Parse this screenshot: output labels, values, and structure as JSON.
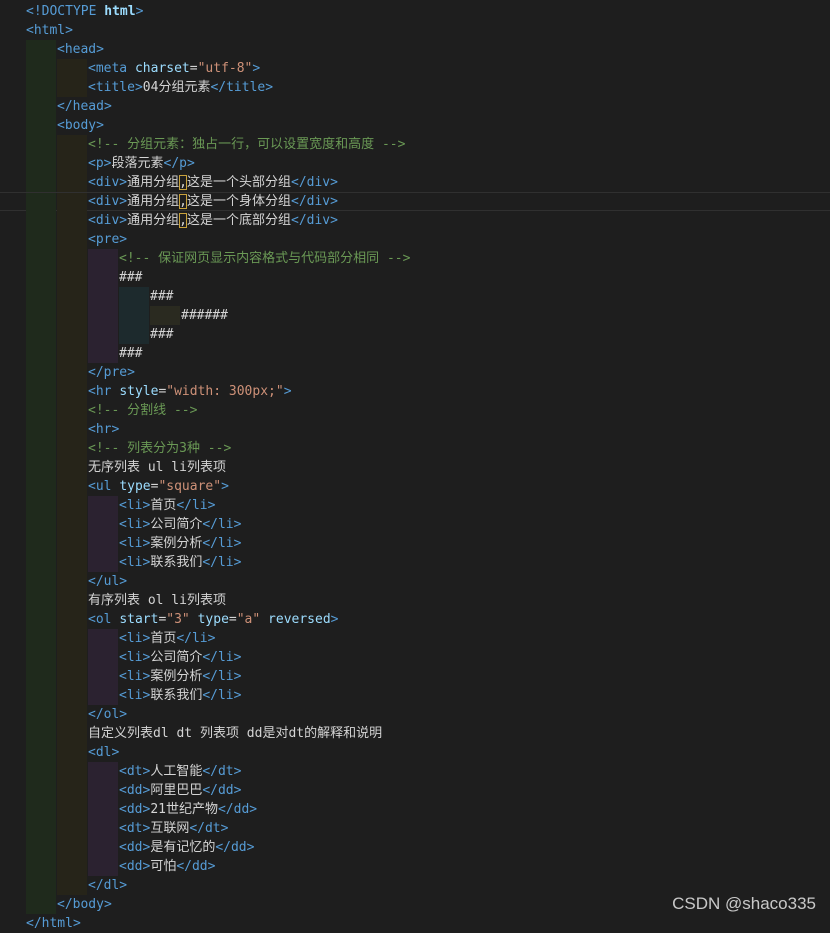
{
  "watermark": "CSDN @shaco335",
  "lines": [
    {
      "indent": 0,
      "segs": [
        {
          "t": "tag",
          "v": "<!DOCTYPE "
        },
        {
          "t": "att-b",
          "v": "html"
        },
        {
          "t": "tag",
          "v": ">"
        }
      ]
    },
    {
      "indent": 0,
      "segs": [
        {
          "t": "tag",
          "v": "<html>"
        }
      ]
    },
    {
      "indent": 1,
      "segs": [
        {
          "t": "tag",
          "v": "<head>"
        }
      ]
    },
    {
      "indent": 2,
      "segs": [
        {
          "t": "tag",
          "v": "<meta "
        },
        {
          "t": "att",
          "v": "charset"
        },
        {
          "t": "txt",
          "v": "="
        },
        {
          "t": "str",
          "v": "\"utf-8\""
        },
        {
          "t": "tag",
          "v": ">"
        }
      ]
    },
    {
      "indent": 2,
      "segs": [
        {
          "t": "tag",
          "v": "<title>"
        },
        {
          "t": "txt",
          "v": "04分组元素"
        },
        {
          "t": "tag",
          "v": "</title>"
        }
      ]
    },
    {
      "indent": 1,
      "segs": [
        {
          "t": "tag",
          "v": "</head>"
        }
      ]
    },
    {
      "indent": 1,
      "segs": [
        {
          "t": "tag",
          "v": "<body>"
        }
      ]
    },
    {
      "indent": 2,
      "segs": [
        {
          "t": "com",
          "v": "<!-- 分组元素：独占一行，可以设置宽度和高度 -->"
        }
      ]
    },
    {
      "indent": 2,
      "segs": [
        {
          "t": "tag",
          "v": "<p>"
        },
        {
          "t": "txt",
          "v": "段落元素"
        },
        {
          "t": "tag",
          "v": "</p>"
        }
      ]
    },
    {
      "indent": 2,
      "segs": [
        {
          "t": "tag",
          "v": "<div>"
        },
        {
          "t": "txt",
          "v": "通用分组"
        },
        {
          "t": "hl",
          "v": ","
        },
        {
          "t": "txt",
          "v": "这是一个头部分组"
        },
        {
          "t": "tag",
          "v": "</div>"
        }
      ]
    },
    {
      "indent": 2,
      "active": true,
      "segs": [
        {
          "t": "tag",
          "v": "<div>"
        },
        {
          "t": "txt",
          "v": "通用分组"
        },
        {
          "t": "hl",
          "v": ","
        },
        {
          "t": "txt",
          "v": "这是一个身体分组"
        },
        {
          "t": "tag",
          "v": "</div>"
        }
      ]
    },
    {
      "indent": 2,
      "segs": [
        {
          "t": "tag",
          "v": "<div>"
        },
        {
          "t": "txt",
          "v": "通用分组"
        },
        {
          "t": "hl",
          "v": ","
        },
        {
          "t": "txt",
          "v": "这是一个底部分组"
        },
        {
          "t": "tag",
          "v": "</div>"
        }
      ]
    },
    {
      "indent": 2,
      "segs": [
        {
          "t": "tag",
          "v": "<pre>"
        }
      ]
    },
    {
      "indent": 3,
      "segs": [
        {
          "t": "com",
          "v": "<!-- 保证网页显示内容格式与代码部分相同 -->"
        }
      ]
    },
    {
      "indent": 3,
      "segs": [
        {
          "t": "txt",
          "v": "###"
        }
      ]
    },
    {
      "indent": 4,
      "segs": [
        {
          "t": "txt",
          "v": "###"
        }
      ]
    },
    {
      "indent": 5,
      "segs": [
        {
          "t": "txt",
          "v": "######"
        }
      ]
    },
    {
      "indent": 4,
      "segs": [
        {
          "t": "txt",
          "v": "###"
        }
      ]
    },
    {
      "indent": 3,
      "segs": [
        {
          "t": "txt",
          "v": "###"
        }
      ]
    },
    {
      "indent": 2,
      "segs": [
        {
          "t": "tag",
          "v": "</pre>"
        }
      ]
    },
    {
      "indent": 2,
      "segs": [
        {
          "t": "tag",
          "v": "<hr "
        },
        {
          "t": "att",
          "v": "style"
        },
        {
          "t": "txt",
          "v": "="
        },
        {
          "t": "str",
          "v": "\"width: 300px;\""
        },
        {
          "t": "tag",
          "v": ">"
        }
      ]
    },
    {
      "indent": 2,
      "segs": [
        {
          "t": "com",
          "v": "<!-- 分割线 -->"
        }
      ]
    },
    {
      "indent": 2,
      "segs": [
        {
          "t": "tag",
          "v": "<hr>"
        }
      ]
    },
    {
      "indent": 2,
      "segs": [
        {
          "t": "com",
          "v": "<!-- 列表分为3种 -->"
        }
      ]
    },
    {
      "indent": 2,
      "segs": [
        {
          "t": "txt",
          "v": "无序列表 ul li列表项"
        }
      ]
    },
    {
      "indent": 2,
      "segs": [
        {
          "t": "tag",
          "v": "<ul "
        },
        {
          "t": "att",
          "v": "type"
        },
        {
          "t": "txt",
          "v": "="
        },
        {
          "t": "str",
          "v": "\"square\""
        },
        {
          "t": "tag",
          "v": ">"
        }
      ]
    },
    {
      "indent": 3,
      "segs": [
        {
          "t": "tag",
          "v": "<li>"
        },
        {
          "t": "txt",
          "v": "首页"
        },
        {
          "t": "tag",
          "v": "</li>"
        }
      ]
    },
    {
      "indent": 3,
      "segs": [
        {
          "t": "tag",
          "v": "<li>"
        },
        {
          "t": "txt",
          "v": "公司简介"
        },
        {
          "t": "tag",
          "v": "</li>"
        }
      ]
    },
    {
      "indent": 3,
      "segs": [
        {
          "t": "tag",
          "v": "<li>"
        },
        {
          "t": "txt",
          "v": "案例分析"
        },
        {
          "t": "tag",
          "v": "</li>"
        }
      ]
    },
    {
      "indent": 3,
      "segs": [
        {
          "t": "tag",
          "v": "<li>"
        },
        {
          "t": "txt",
          "v": "联系我们"
        },
        {
          "t": "tag",
          "v": "</li>"
        }
      ]
    },
    {
      "indent": 2,
      "segs": [
        {
          "t": "tag",
          "v": "</ul>"
        }
      ]
    },
    {
      "indent": 2,
      "segs": [
        {
          "t": "txt",
          "v": "有序列表 ol li列表项"
        }
      ]
    },
    {
      "indent": 2,
      "segs": [
        {
          "t": "tag",
          "v": "<ol "
        },
        {
          "t": "att",
          "v": "start"
        },
        {
          "t": "txt",
          "v": "="
        },
        {
          "t": "str",
          "v": "\"3\""
        },
        {
          "t": "txt",
          "v": " "
        },
        {
          "t": "att",
          "v": "type"
        },
        {
          "t": "txt",
          "v": "="
        },
        {
          "t": "str",
          "v": "\"a\""
        },
        {
          "t": "txt",
          "v": " "
        },
        {
          "t": "att",
          "v": "reversed"
        },
        {
          "t": "tag",
          "v": ">"
        }
      ]
    },
    {
      "indent": 3,
      "segs": [
        {
          "t": "tag",
          "v": "<li>"
        },
        {
          "t": "txt",
          "v": "首页"
        },
        {
          "t": "tag",
          "v": "</li>"
        }
      ]
    },
    {
      "indent": 3,
      "segs": [
        {
          "t": "tag",
          "v": "<li>"
        },
        {
          "t": "txt",
          "v": "公司简介"
        },
        {
          "t": "tag",
          "v": "</li>"
        }
      ]
    },
    {
      "indent": 3,
      "segs": [
        {
          "t": "tag",
          "v": "<li>"
        },
        {
          "t": "txt",
          "v": "案例分析"
        },
        {
          "t": "tag",
          "v": "</li>"
        }
      ]
    },
    {
      "indent": 3,
      "segs": [
        {
          "t": "tag",
          "v": "<li>"
        },
        {
          "t": "txt",
          "v": "联系我们"
        },
        {
          "t": "tag",
          "v": "</li>"
        }
      ]
    },
    {
      "indent": 2,
      "segs": [
        {
          "t": "tag",
          "v": "</ol>"
        }
      ]
    },
    {
      "indent": 2,
      "segs": [
        {
          "t": "txt",
          "v": "自定义列表dl dt 列表项 dd是对dt的解释和说明"
        }
      ]
    },
    {
      "indent": 2,
      "segs": [
        {
          "t": "tag",
          "v": "<dl>"
        }
      ]
    },
    {
      "indent": 3,
      "segs": [
        {
          "t": "tag",
          "v": "<dt>"
        },
        {
          "t": "txt",
          "v": "人工智能"
        },
        {
          "t": "tag",
          "v": "</dt>"
        }
      ]
    },
    {
      "indent": 3,
      "segs": [
        {
          "t": "tag",
          "v": "<dd>"
        },
        {
          "t": "txt",
          "v": "阿里巴巴"
        },
        {
          "t": "tag",
          "v": "</dd>"
        }
      ]
    },
    {
      "indent": 3,
      "segs": [
        {
          "t": "tag",
          "v": "<dd>"
        },
        {
          "t": "txt",
          "v": "21世纪产物"
        },
        {
          "t": "tag",
          "v": "</dd>"
        }
      ]
    },
    {
      "indent": 3,
      "segs": [
        {
          "t": "tag",
          "v": "<dt>"
        },
        {
          "t": "txt",
          "v": "互联网"
        },
        {
          "t": "tag",
          "v": "</dt>"
        }
      ]
    },
    {
      "indent": 3,
      "segs": [
        {
          "t": "tag",
          "v": "<dd>"
        },
        {
          "t": "txt",
          "v": "是有记忆的"
        },
        {
          "t": "tag",
          "v": "</dd>"
        }
      ]
    },
    {
      "indent": 3,
      "segs": [
        {
          "t": "tag",
          "v": "<dd>"
        },
        {
          "t": "txt",
          "v": "可怕"
        },
        {
          "t": "tag",
          "v": "</dd>"
        }
      ]
    },
    {
      "indent": 2,
      "segs": [
        {
          "t": "tag",
          "v": "</dl>"
        }
      ]
    },
    {
      "indent": 1,
      "segs": [
        {
          "t": "tag",
          "v": "</body>"
        }
      ]
    },
    {
      "indent": 0,
      "segs": [
        {
          "t": "tag",
          "v": "</html>"
        }
      ]
    }
  ]
}
